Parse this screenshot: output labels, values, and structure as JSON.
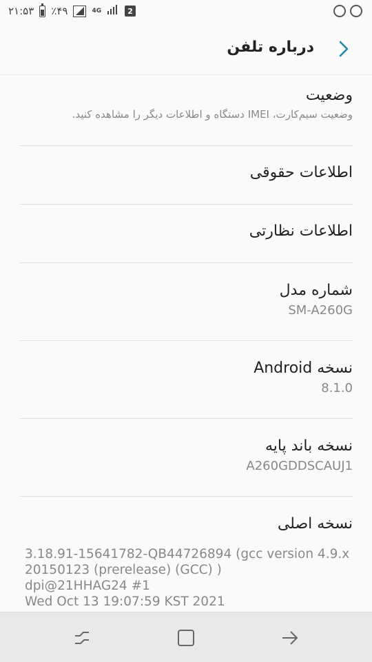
{
  "status_bar": {
    "time": "۲۱:۵۳",
    "battery": "٪۴۹",
    "network": "4G",
    "sim_badge": "2"
  },
  "header": {
    "title": "درباره تلفن"
  },
  "items": [
    {
      "title": "وضعیت",
      "subtitle": "وضعیت سیم‌کارت، IMEI دستگاه و اطلاعات دیگر را مشاهده کنید."
    },
    {
      "title": "اطلاعات حقوقی"
    },
    {
      "title": "اطلاعات نظارتی"
    },
    {
      "title": "شماره مدل",
      "subtitle": "SM-A260G"
    },
    {
      "title": "نسخه Android",
      "subtitle": "8.1.0"
    },
    {
      "title": "نسخه باند پایه",
      "subtitle": "A260GDDSCAUJ1"
    },
    {
      "title": "نسخه اصلی"
    }
  ],
  "kernel_lines": [
    "3.18.91-15641782-QB44726894 (gcc version 4.9.x",
    "20150123 (prerelease) (GCC) )",
    "dpi@21HHAG24 #1",
    "Wed Oct 13 19:07:59 KST 2021"
  ]
}
